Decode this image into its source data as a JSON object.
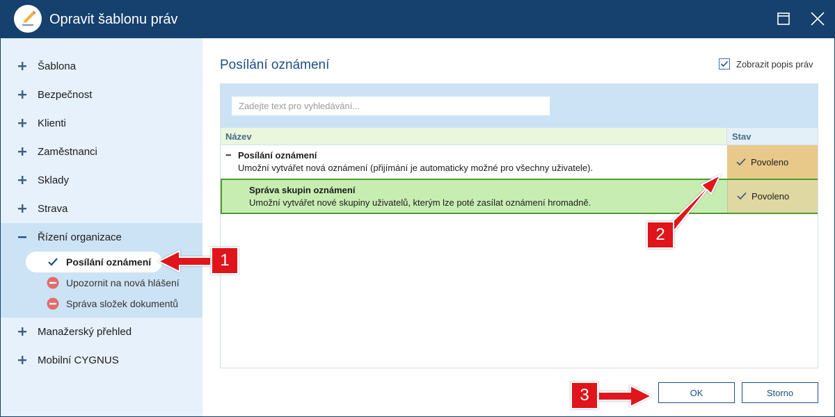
{
  "window": {
    "title": "Opravit šablonu práv",
    "logo_icon": "pencil-logo-icon",
    "maximize_icon": "maximize-icon",
    "close_icon": "close-icon",
    "titlebar_color": "#16406d"
  },
  "sidebar": {
    "items": [
      {
        "label": "Šablona",
        "icon": "plus-icon"
      },
      {
        "label": "Bezpečnost",
        "icon": "plus-icon"
      },
      {
        "label": "Klienti",
        "icon": "plus-icon"
      },
      {
        "label": "Zaměstnanci",
        "icon": "plus-icon"
      },
      {
        "label": "Sklady",
        "icon": "plus-icon"
      },
      {
        "label": "Strava",
        "icon": "plus-icon"
      },
      {
        "label": "Řízení organizace",
        "icon": "minus-icon",
        "expanded": true,
        "children": [
          {
            "label": "Posílání oznámení",
            "icon": "check-icon",
            "selected": true
          },
          {
            "label": "Upozornit na nová hlášení",
            "icon": "denied-icon"
          },
          {
            "label": "Správa složek dokumentů",
            "icon": "denied-icon"
          }
        ]
      },
      {
        "label": "Manažerský přehled",
        "icon": "plus-icon"
      },
      {
        "label": "Mobilní CYGNUS",
        "icon": "plus-icon"
      }
    ]
  },
  "main": {
    "section_title": "Posílání oznámení",
    "show_descriptions": {
      "label": "Zobrazit popis práv",
      "checked": true
    },
    "search": {
      "placeholder": "Zadejte text pro vyhledávání...",
      "value": ""
    },
    "columns": {
      "name": "Název",
      "state": "Stav"
    },
    "rows": [
      {
        "collapse_glyph": "−",
        "title": "Posílání oznámení",
        "description": "Umožní vytvářet nová oznámení (přijímání je automaticky možné pro všechny uživatele).",
        "state": "Povoleno",
        "state_icon": "check-icon"
      },
      {
        "title": "Správa skupin oznámení",
        "description": "Umožní vytvářet nové skupiny uživatelů, kterým lze poté zasílat oznámení hromadně.",
        "state": "Povoleno",
        "state_icon": "check-icon",
        "selected": true
      }
    ]
  },
  "footer": {
    "ok_label": "OK",
    "cancel_label": "Storno"
  },
  "callouts": [
    "1",
    "2",
    "3"
  ],
  "colors": {
    "accent": "#1b4f85",
    "callout": "#e0141b",
    "allowed_state": "#e9c98a",
    "selected_row": "#c8edb2"
  }
}
